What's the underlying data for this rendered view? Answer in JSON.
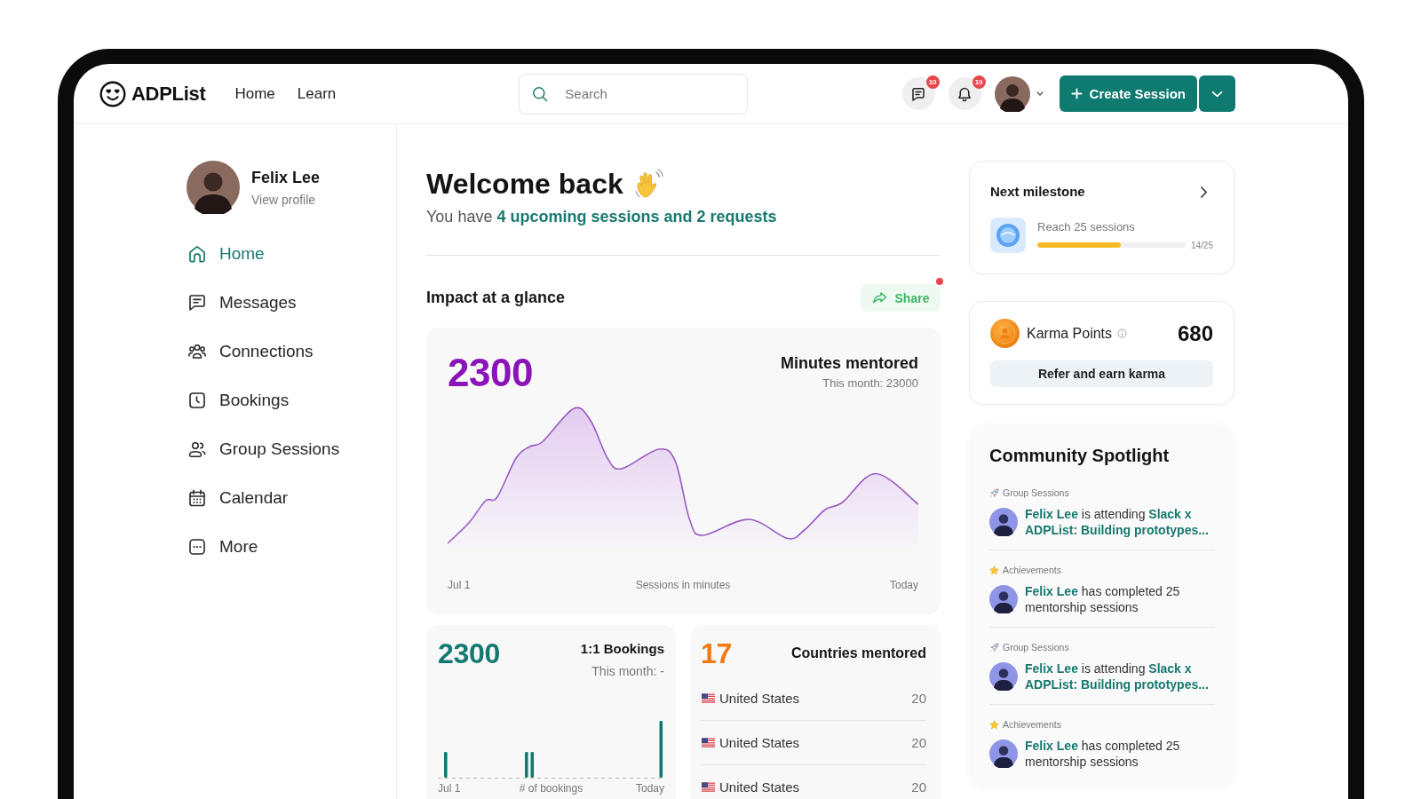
{
  "header": {
    "logo": "ADPList",
    "nav": [
      {
        "label": "Home"
      },
      {
        "label": "Learn"
      }
    ],
    "search": {
      "placeholder": "Search"
    },
    "messages_badge": "10",
    "notifications_badge": "10",
    "create_button": "Create Session"
  },
  "sidebar": {
    "profile": {
      "name": "Felix Lee",
      "link": "View profile"
    },
    "items": [
      {
        "label": "Home",
        "selected": true
      },
      {
        "label": "Messages",
        "selected": false
      },
      {
        "label": "Connections",
        "selected": false
      },
      {
        "label": "Bookings",
        "selected": false
      },
      {
        "label": "Group Sessions",
        "selected": false
      },
      {
        "label": "Calendar",
        "selected": false
      },
      {
        "label": "More",
        "selected": false
      }
    ]
  },
  "welcome": {
    "title": "Welcome back",
    "subtitle": "You have **4 upcoming sessions and 2 requests**"
  },
  "impact": {
    "title": "Impact at a glance",
    "share": {
      "label": "Share",
      "alert": true
    },
    "minutes": {
      "value": "2300",
      "title": "Minutes mentored",
      "note": "This month: 23000",
      "axis_start": "Jul 1",
      "axis_caption": "Sessions in minutes",
      "axis_end": "Today"
    },
    "bookings": {
      "value": "2300",
      "title": "1:1 Bookings",
      "note": "This month: -",
      "axis_start": "Jul 1",
      "axis_caption": "# of bookings",
      "axis_end": "Today"
    },
    "countries": {
      "value": "17",
      "title": "Countries mentored",
      "rows": [
        {
          "country": "United States",
          "count": "20"
        },
        {
          "country": "United States",
          "count": "20"
        },
        {
          "country": "United States",
          "count": "20"
        }
      ]
    }
  },
  "milestone": {
    "title": "Next milestone",
    "goal": "Reach 25 sessions",
    "level": 0.56,
    "progress": "14/25"
  },
  "karma": {
    "title": "Karma Points",
    "points": "680",
    "button": "Refer and earn karma"
  },
  "spotlight": {
    "title": "Community Spotlight",
    "items": [
      {
        "kind": "group_session",
        "category": "Group Sessions",
        "text": "**Felix Lee** is attending **Slack x ADPList: Building prototypes...**"
      },
      {
        "kind": "achievement",
        "category": "Achievements",
        "text": "**Felix Lee** has completed 25 mentorship sessions"
      },
      {
        "kind": "group_session",
        "category": "Group Sessions",
        "text": "**Felix Lee** is attending **Slack x ADPList: Building prototypes...**"
      },
      {
        "kind": "achievement",
        "category": "Achievements",
        "text": "**Felix Lee** has completed 25 mentorship sessions"
      }
    ]
  }
}
